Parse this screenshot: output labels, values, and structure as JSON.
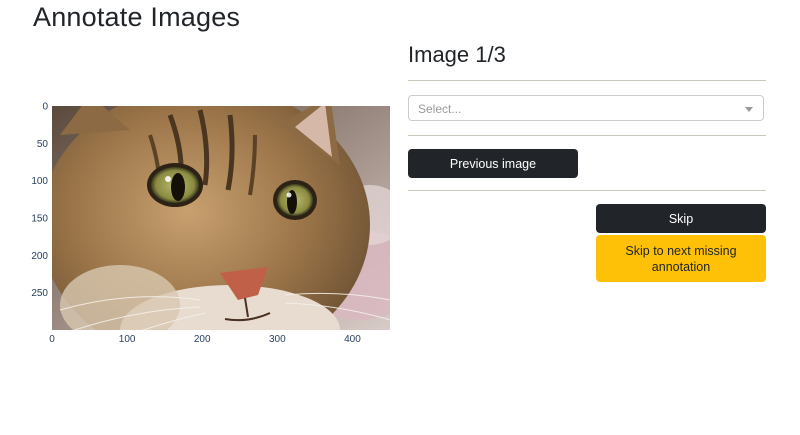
{
  "page": {
    "title": "Annotate Images"
  },
  "image_plot": {
    "image_name": "cat-photo",
    "x_ticks": [
      "0",
      "100",
      "200",
      "300",
      "400"
    ],
    "y_ticks": [
      "0",
      "50",
      "100",
      "150",
      "200",
      "250"
    ],
    "x_range": [
      0,
      450
    ],
    "y_range": [
      0,
      300
    ]
  },
  "panel": {
    "image_counter": "Image 1/3",
    "label_select": {
      "placeholder": "Select..."
    },
    "previous_button": "Previous image",
    "skip_button": "Skip",
    "skip_missing_button": "Skip to next missing annotation"
  },
  "colors": {
    "dark_button": "#212529",
    "warning_button": "#ffc107",
    "divider": "#c8c8b8"
  }
}
